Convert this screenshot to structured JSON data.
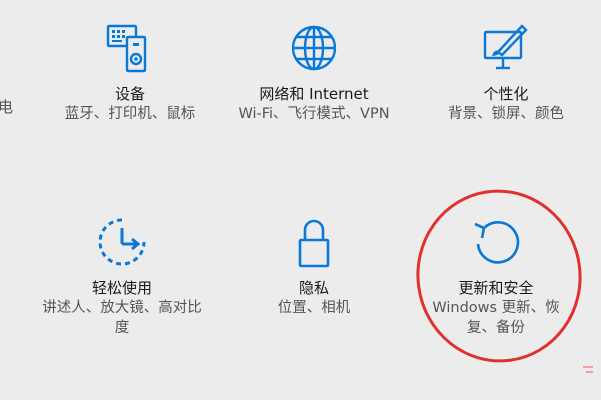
{
  "colors": {
    "background": "#ececec",
    "icon_blue": "#0a78d7",
    "annotation_red": "#e0312f"
  },
  "edge_fragment": "电",
  "tiles": {
    "devices": {
      "title": "设备",
      "desc": "蓝牙、打印机、鼠标",
      "icon": "devices-icon"
    },
    "network": {
      "title": "网络和 Internet",
      "desc": "Wi-Fi、飞行模式、VPN",
      "icon": "globe-icon"
    },
    "personalization": {
      "title": "个性化",
      "desc": "背景、锁屏、颜色",
      "icon": "personalization-icon"
    },
    "ease": {
      "title": "轻松使用",
      "desc": "讲述人、放大镜、高对比度",
      "icon": "ease-of-access-icon"
    },
    "privacy": {
      "title": "隐私",
      "desc": "位置、相机",
      "icon": "lock-icon"
    },
    "update": {
      "title": "更新和安全",
      "desc": "Windows 更新、恢复、备份",
      "icon": "update-icon"
    }
  }
}
